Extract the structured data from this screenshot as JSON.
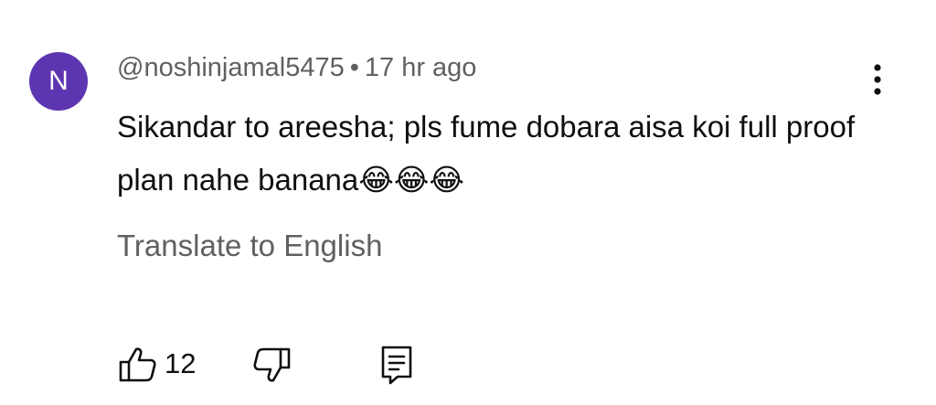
{
  "comment": {
    "avatar_letter": "N",
    "avatar_color": "#5e35b1",
    "author": "@noshinjamal5475",
    "separator": "•",
    "time": "17 hr ago",
    "text": "Sikandar to areesha; pls fume dobara aisa koi full proof plan nahe banana😂😂😂",
    "translate_label": "Translate to English",
    "like_count": "12"
  },
  "icons": {
    "more": "more-vertical-icon",
    "like": "thumbs-up-icon",
    "dislike": "thumbs-down-icon",
    "reply": "reply-comment-icon"
  }
}
